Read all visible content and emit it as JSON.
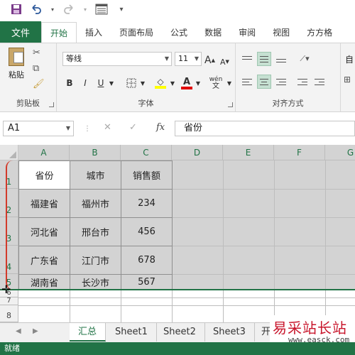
{
  "qat": {
    "save_icon": "save-icon",
    "undo_icon": "undo-icon",
    "redo_icon": "redo-icon",
    "form_icon": "form-icon",
    "customize_icon": "chevron-down-icon"
  },
  "tabs": {
    "file": "文件",
    "items": [
      "开始",
      "插入",
      "页面布局",
      "公式",
      "数据",
      "审阅",
      "视图",
      "方方格"
    ],
    "active_index": 0
  },
  "ribbon": {
    "clipboard": {
      "paste_label": "粘贴",
      "group_label": "剪贴板"
    },
    "font": {
      "font_name": "等线",
      "font_size": "11",
      "grow_label": "A",
      "shrink_label": "A",
      "bold_label": "B",
      "italic_label": "I",
      "underline_label": "U",
      "fill_label": "◇",
      "color_label": "A",
      "phonetic_label": "wén",
      "group_label": "字体"
    },
    "alignment": {
      "group_label": "对齐方式",
      "wrap_label": "自"
    }
  },
  "formula_bar": {
    "name_box": "A1",
    "cancel_icon": "close-icon",
    "enter_icon": "check-icon",
    "fx_label": "fx",
    "formula": "省份"
  },
  "grid": {
    "columns": [
      "A",
      "B",
      "C",
      "D",
      "E",
      "F",
      "G"
    ],
    "rows": [
      "1",
      "2",
      "3",
      "4",
      "5",
      "6",
      "7",
      "8"
    ],
    "table": [
      [
        "省份",
        "城市",
        "销售额"
      ],
      [
        "福建省",
        "福州市",
        "234"
      ],
      [
        "河北省",
        "邢台市",
        "456"
      ],
      [
        "广东省",
        "江门市",
        "678"
      ],
      [
        "湖南省",
        "长沙市",
        "567"
      ]
    ]
  },
  "sheets": {
    "tabs": [
      "汇总",
      "Sheet1",
      "Sheet2",
      "Sheet3",
      "开"
    ],
    "active_index": 0
  },
  "watermark": {
    "title": "易采站长站",
    "url": "www.easck.com"
  },
  "status": {
    "text": "就绪"
  },
  "colors": {
    "accent": "#217346",
    "selection": "#d3d3d3",
    "mark": "#d23a2a"
  }
}
